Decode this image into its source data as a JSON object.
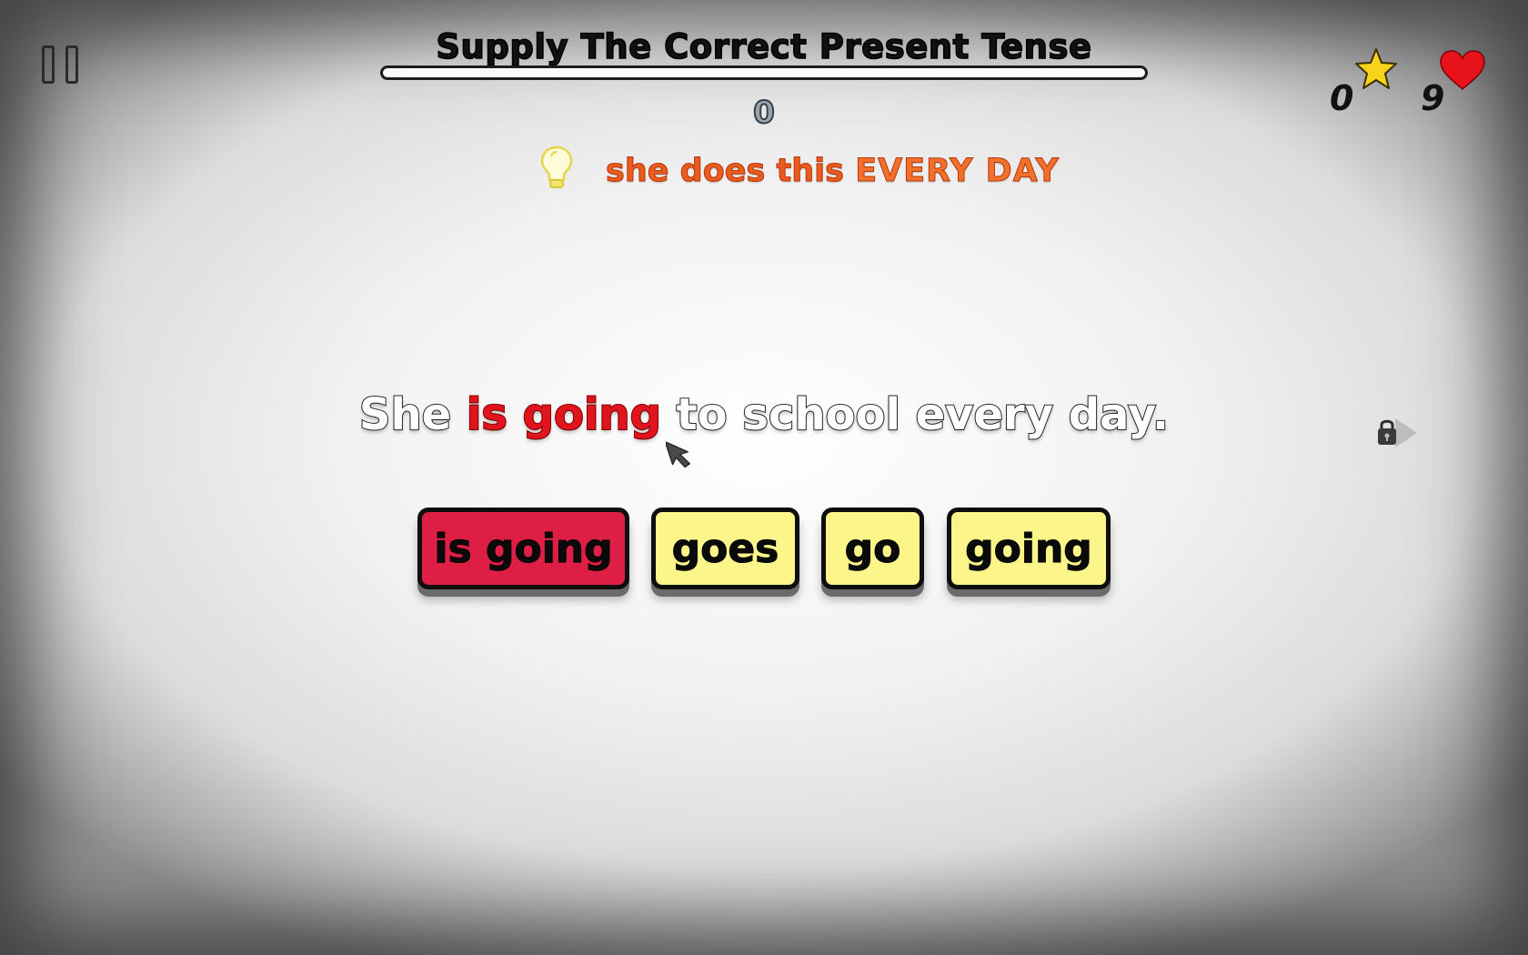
{
  "header": {
    "title": "Supply The Correct Present Tense",
    "progress_fraction": 0,
    "score": "0"
  },
  "hint": {
    "part1": "she does this ",
    "part2": "EVERY DAY"
  },
  "status": {
    "stars": "0",
    "lives": "9"
  },
  "question": {
    "before": "She ",
    "answer": "is going",
    "after": " to school every day."
  },
  "choices": [
    {
      "label": "is going",
      "state": "selected-wrong"
    },
    {
      "label": "goes",
      "state": "default"
    },
    {
      "label": "go",
      "state": "default"
    },
    {
      "label": "going",
      "state": "default"
    }
  ],
  "colors": {
    "choice_default": "#fbf58a",
    "choice_wrong": "#dd1f45",
    "hint": "#ea5b1e",
    "answer_text": "#e0141c",
    "star": "#f7d31b",
    "heart": "#e8121b"
  },
  "icons": {
    "pause": "pause-icon",
    "hint": "lightbulb-icon",
    "star": "star-icon",
    "heart": "heart-icon",
    "next": "locked-next-arrow-icon",
    "cursor": "mouse-cursor-icon"
  }
}
